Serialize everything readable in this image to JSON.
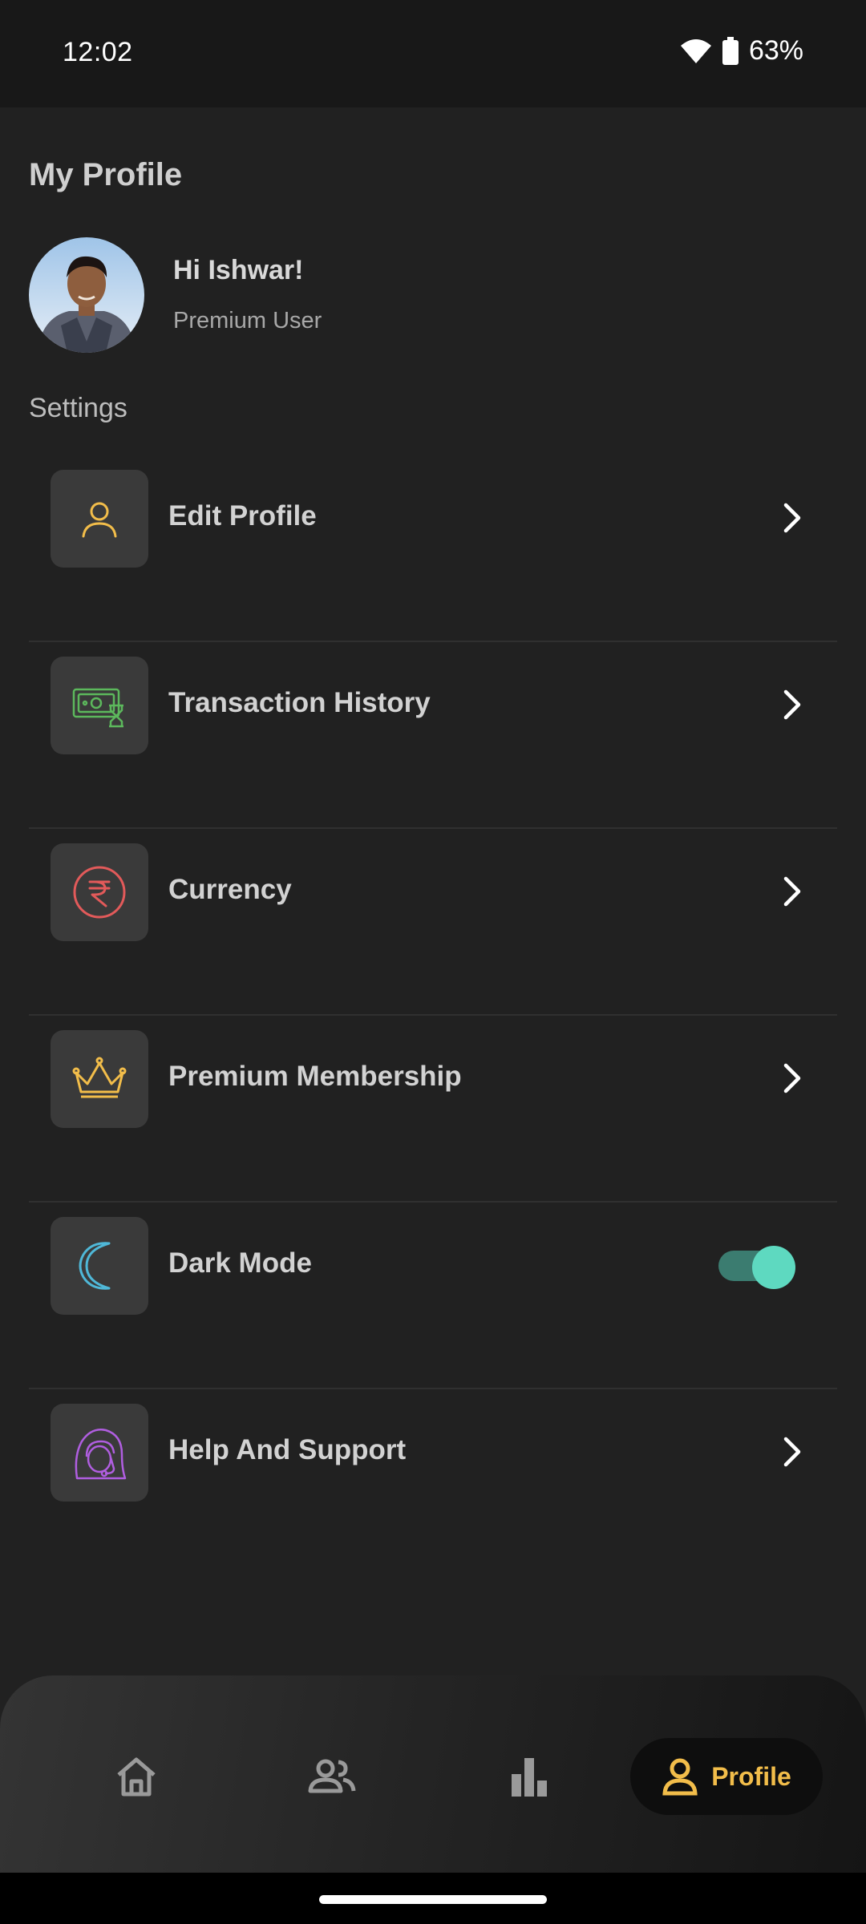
{
  "status_bar": {
    "time": "12:02",
    "battery": "63%"
  },
  "profile": {
    "title": "My Profile",
    "greeting": "Hi Ishwar!",
    "tier": "Premium User"
  },
  "settings": {
    "section_label": "Settings",
    "items": [
      {
        "label": "Edit Profile",
        "icon": "user-icon",
        "color": "#f2bd4a"
      },
      {
        "label": "Transaction History",
        "icon": "money-hourglass-icon",
        "color": "#5cb85c"
      },
      {
        "label": "Currency",
        "icon": "rupee-icon",
        "color": "#e25a5a"
      },
      {
        "label": "Premium Membership",
        "icon": "crown-icon",
        "color": "#f2bd4a"
      },
      {
        "label": "Dark Mode",
        "icon": "moon-icon",
        "color": "#4fb8d8",
        "toggle_on": true
      },
      {
        "label": "Help And Support",
        "icon": "support-agent-icon",
        "color": "#b05ee0"
      }
    ]
  },
  "bottom_nav": {
    "items": [
      {
        "icon": "home-icon"
      },
      {
        "icon": "people-icon"
      },
      {
        "icon": "bar-chart-icon"
      },
      {
        "icon": "profile-icon",
        "label": "Profile",
        "active": true
      }
    ],
    "active_color": "#f2bd4a"
  }
}
